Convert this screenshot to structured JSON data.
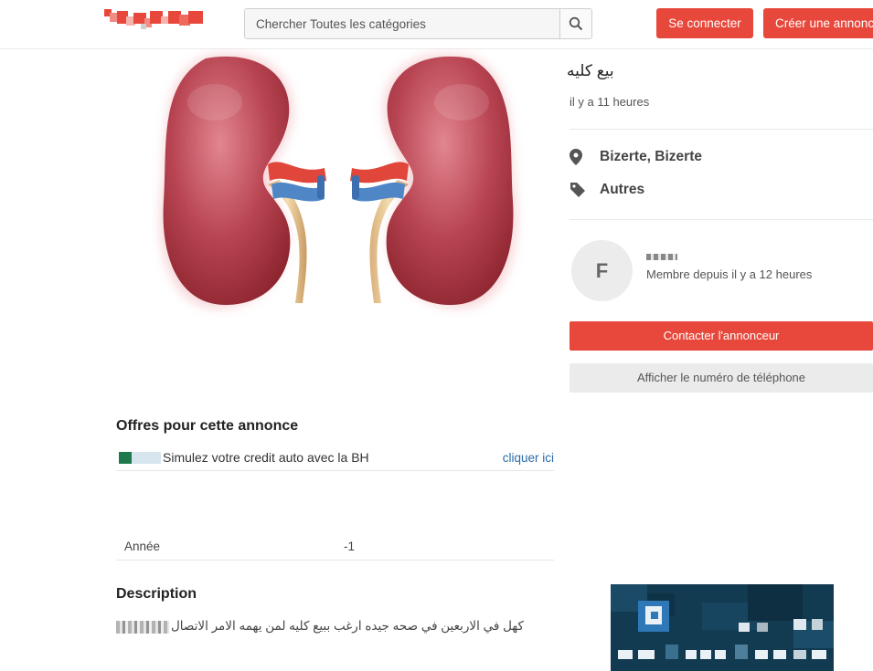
{
  "header": {
    "search": {
      "placeholder": "Chercher Toutes les catégories"
    },
    "login_label": "Se connecter",
    "create_label": "Créer une annonce"
  },
  "ad": {
    "title": "بيع كليه",
    "posted": "il y a 11 heures",
    "location": "Bizerte, Bizerte",
    "category": "Autres"
  },
  "seller": {
    "initial": "F",
    "member_since": "Membre depuis il y a 12 heures"
  },
  "actions": {
    "contact_label": "Contacter l'annonceur",
    "phone_label": "Afficher le numéro de téléphone"
  },
  "offers": {
    "title": "Offres pour cette annonce",
    "items": [
      {
        "text": "Simulez votre credit auto avec la BH",
        "link": "cliquer ici"
      }
    ]
  },
  "specs": [
    {
      "label": "Année",
      "value": "-1"
    }
  ],
  "description": {
    "title": "Description",
    "text": "كهل في الاربعين في صحه جيده ارغب ببيع كليه لمن يهمه الامر الاتصال"
  },
  "icons": {
    "search": "search-icon",
    "location": "map-pin-icon",
    "category": "tag-icon"
  },
  "colors": {
    "accent": "#e8483b",
    "link": "#2b6aa8"
  }
}
